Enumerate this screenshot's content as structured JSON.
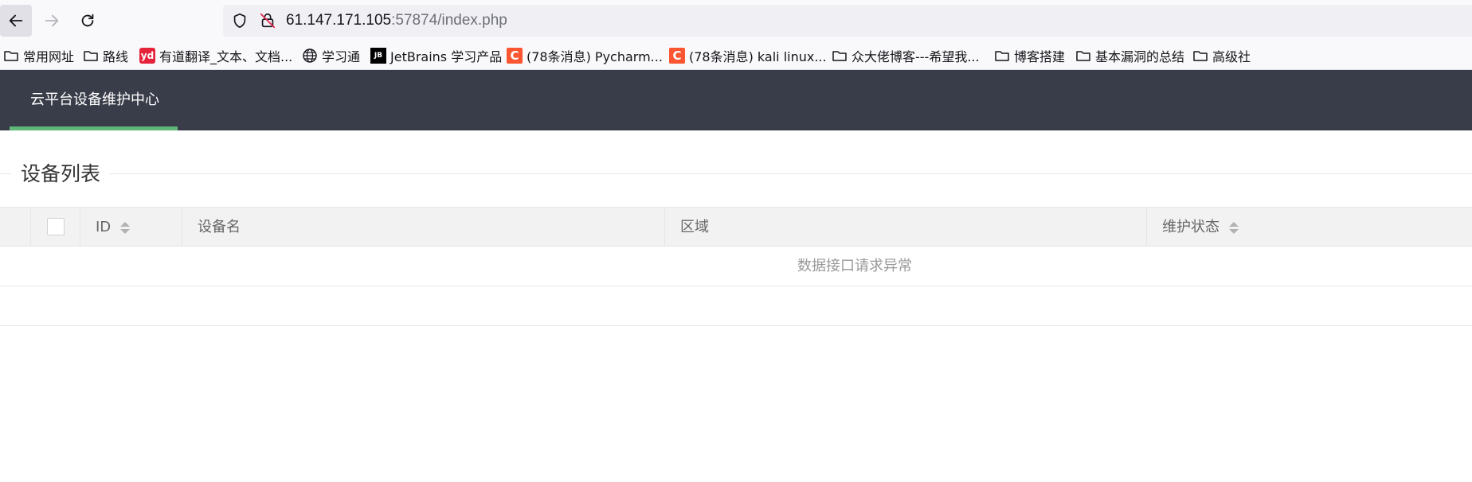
{
  "browser": {
    "url_host": "61.147.171.105",
    "url_rest": ":57874/index.php"
  },
  "bookmarks": [
    {
      "label": "常用网址",
      "icon": "folder-icon"
    },
    {
      "label": "路线",
      "icon": "folder-icon"
    },
    {
      "label": "有道翻译_文本、文档...",
      "icon": "youdao-icon",
      "icon_text": "yd"
    },
    {
      "label": "学习通",
      "icon": "globe-icon"
    },
    {
      "label": "JetBrains 学习产品",
      "icon": "jetbrains-icon",
      "icon_text": "JB"
    },
    {
      "label": "(78条消息) Pycharm...",
      "icon": "csdn-icon",
      "icon_text": "C"
    },
    {
      "label": "(78条消息) kali linux...",
      "icon": "csdn-icon",
      "icon_text": "C"
    },
    {
      "label": "众大佬博客---希望我...",
      "icon": "folder-icon"
    },
    {
      "label": "博客搭建",
      "icon": "folder-icon"
    },
    {
      "label": "基本漏洞的总结",
      "icon": "folder-icon"
    },
    {
      "label": "高级社",
      "icon": "folder-icon"
    }
  ],
  "app": {
    "nav_title": "云平台设备维护中心",
    "colors": {
      "header_bg": "#393d49",
      "accent": "#5fb878"
    }
  },
  "section": {
    "title": "设备列表"
  },
  "table": {
    "columns": [
      "ID",
      "设备名",
      "区域",
      "维护状态"
    ],
    "empty_message": "数据接口请求异常"
  }
}
